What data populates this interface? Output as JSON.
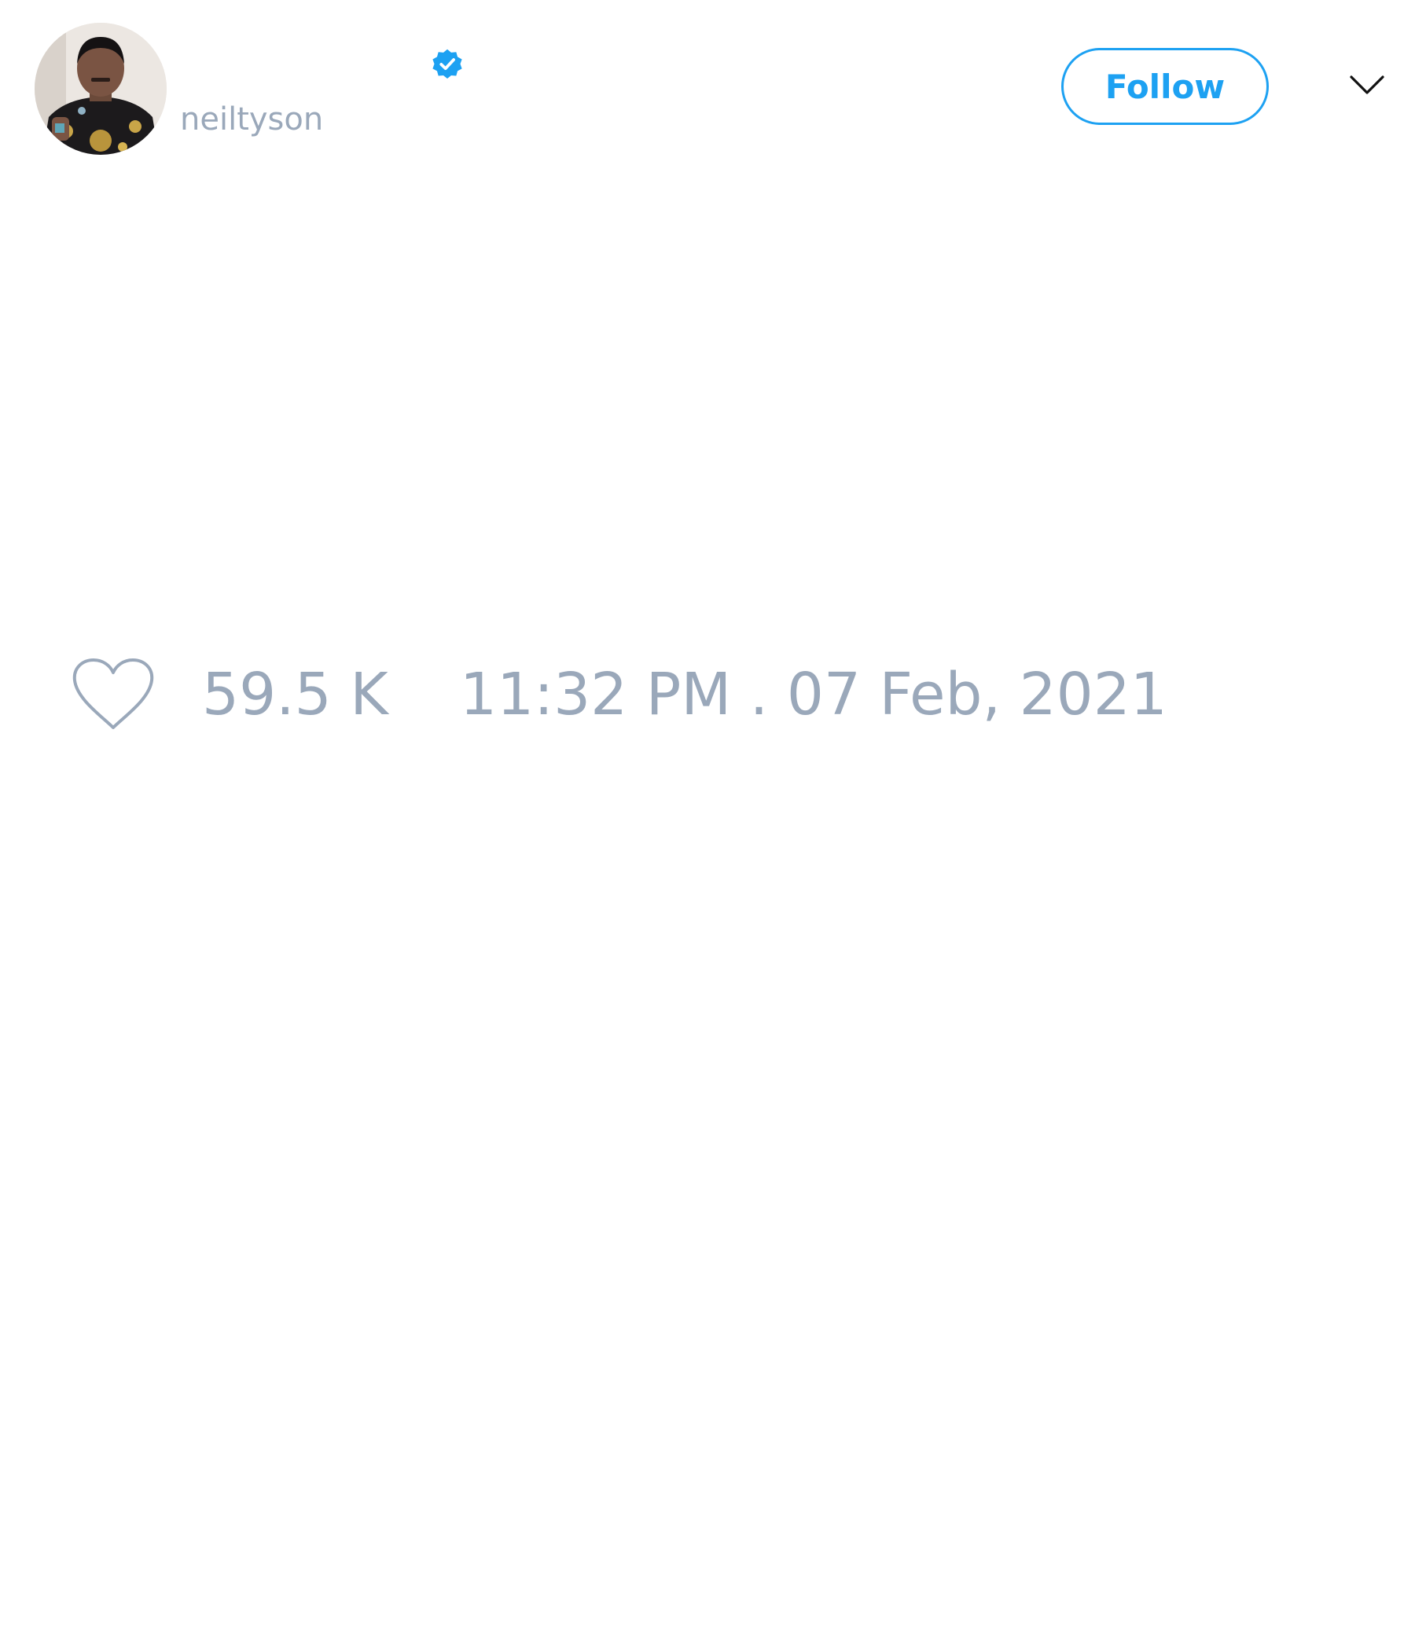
{
  "tweet": {
    "author": {
      "handle": "neiltyson",
      "verified": true,
      "verified_badge_color": "#1da1f2",
      "avatar_icon": "profile-photo"
    },
    "follow_button": {
      "label": "Follow",
      "color": "#1da1f2"
    },
    "menu_icon": "chevron-down-icon",
    "like_icon": "heart-outline-icon",
    "likes": "59.5 K",
    "timestamp": "11:32 PM . 07 Feb, 2021",
    "meta_text_color": "#9aa8ba"
  }
}
